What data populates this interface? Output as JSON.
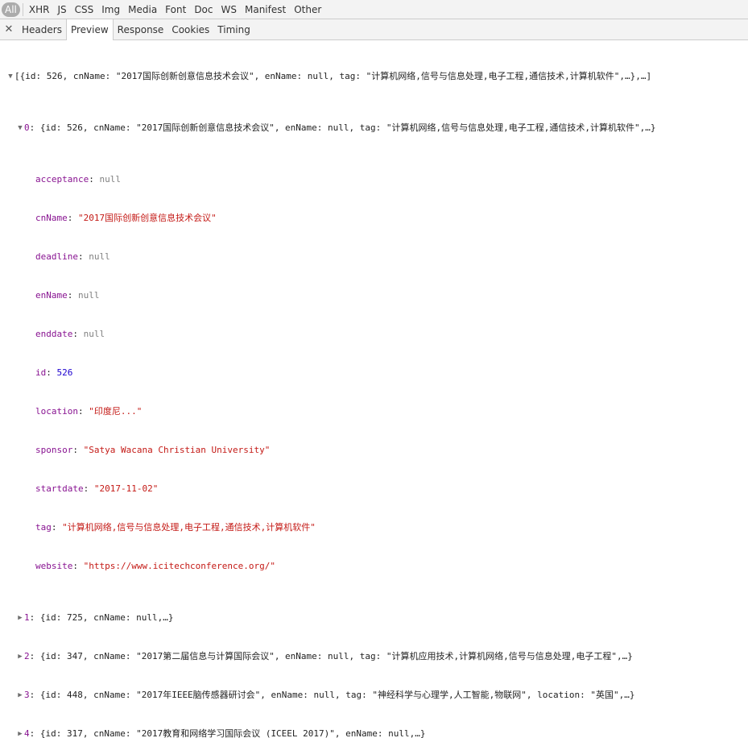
{
  "filters": [
    "All",
    "XHR",
    "JS",
    "CSS",
    "Img",
    "Media",
    "Font",
    "Doc",
    "WS",
    "Manifest",
    "Other"
  ],
  "tabs": [
    "Headers",
    "Preview",
    "Response",
    "Cookies",
    "Timing"
  ],
  "close_glyph": "✕",
  "root_summary": "[{id: 526, cnName: \"2017国际创新创意信息技术会议\", enName: null, tag: \"计算机网络,信号与信息处理,电子工程,通信技术,计算机软件\",…},…]",
  "item0": {
    "index": "0",
    "summary": "{id: 526, cnName: \"2017国际创新创意信息技术会议\", enName: null, tag: \"计算机网络,信号与信息处理,电子工程,通信技术,计算机软件\",…}",
    "props": {
      "acceptance": {
        "key": "acceptance",
        "value": "null"
      },
      "cnName": {
        "key": "cnName",
        "value": "\"2017国际创新创意信息技术会议\""
      },
      "deadline": {
        "key": "deadline",
        "value": "null"
      },
      "enName": {
        "key": "enName",
        "value": "null"
      },
      "enddate": {
        "key": "enddate",
        "value": "null"
      },
      "id": {
        "key": "id",
        "value": "526"
      },
      "location": {
        "key": "location",
        "value": "\"印度尼...\""
      },
      "sponsor": {
        "key": "sponsor",
        "value": "\"Satya Wacana Christian University\""
      },
      "startdate": {
        "key": "startdate",
        "value": "\"2017-11-02\""
      },
      "tag": {
        "key": "tag",
        "value": "\"计算机网络,信号与信息处理,电子工程,通信技术,计算机软件\""
      },
      "website": {
        "key": "website",
        "value": "\"https://www.icitechconference.org/\""
      }
    }
  },
  "items": [
    {
      "index": "1",
      "summary": "{id: 725, cnName: null,…}"
    },
    {
      "index": "2",
      "summary": "{id: 347, cnName: \"2017第二届信息与计算国际会议\", enName: null, tag: \"计算机应用技术,计算机网络,信号与信息处理,电子工程\",…}"
    },
    {
      "index": "3",
      "summary": "{id: 448, cnName: \"2017年IEEE脑传感器研讨会\", enName: null, tag: \"神经科学与心理学,人工智能,物联网\", location: \"英国\",…}"
    },
    {
      "index": "4",
      "summary": "{id: 317, cnName: \"2017教育和网络学习国际会议 (ICEEL 2017)\", enName: null,…}"
    }
  ]
}
